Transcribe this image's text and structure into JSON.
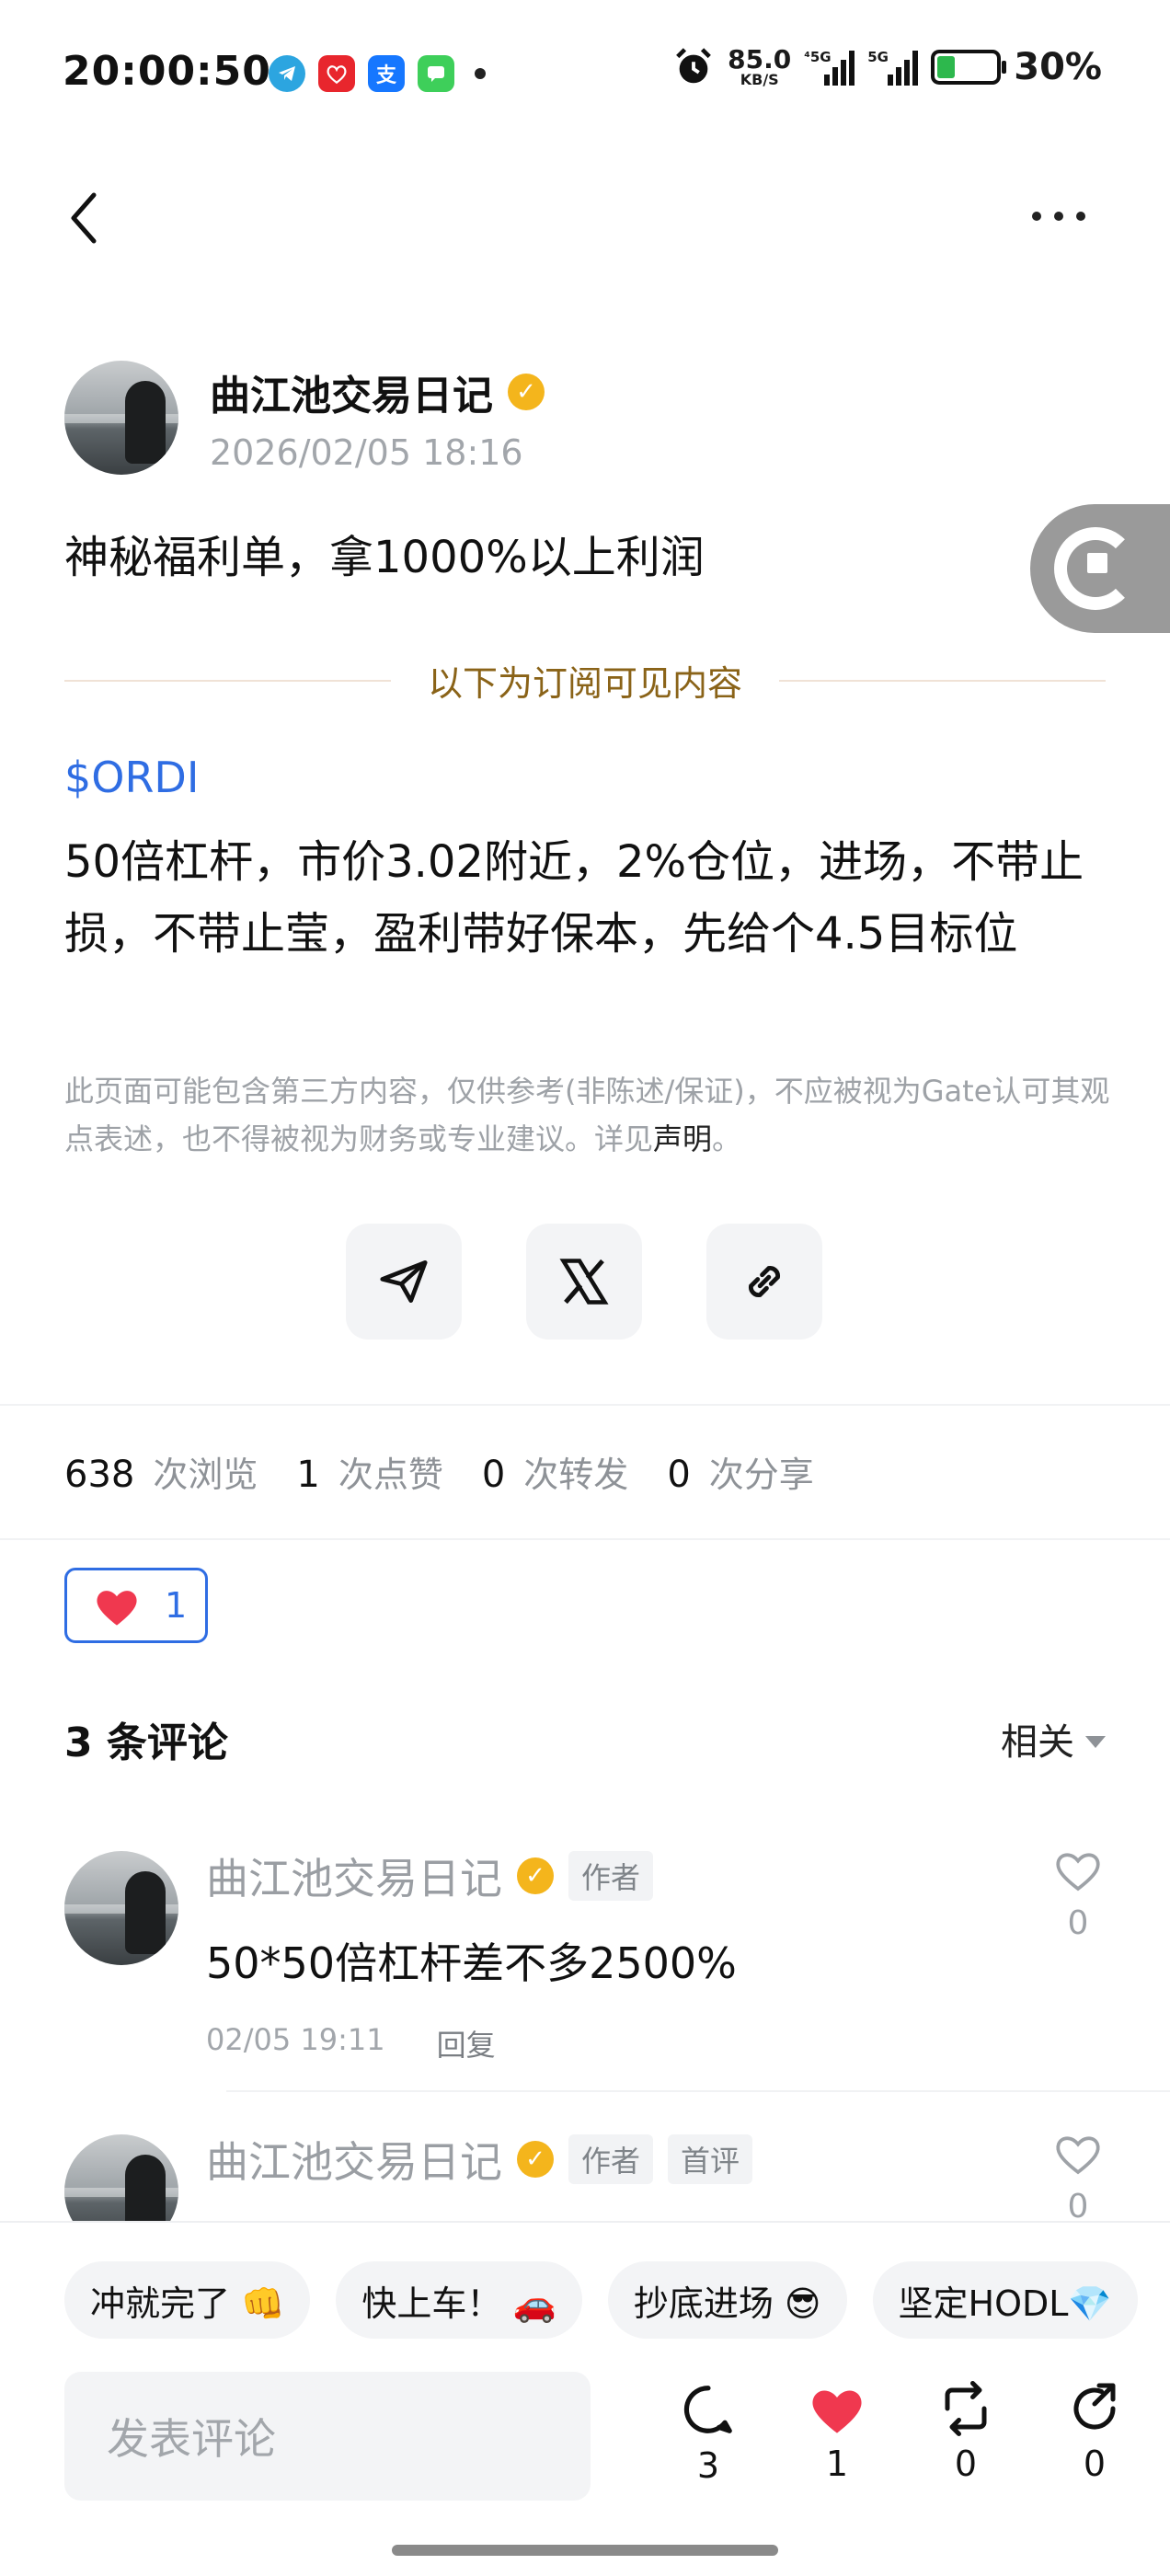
{
  "status_bar": {
    "time": "20:00:50",
    "net_speed_value": "85.0",
    "net_speed_unit": "KB/S",
    "sim1_label": "⁴5G",
    "sim2_label": "5G",
    "battery": "30%",
    "battery_level": 0.3,
    "app_icons": [
      "telegram-icon",
      "taobao-icon",
      "alipay-icon",
      "messages-icon"
    ],
    "app_icon_glyphs": [
      "",
      "",
      "支",
      ""
    ]
  },
  "nav": {
    "back_icon": "chevron-left-icon",
    "more_icon": "more-horizontal-icon"
  },
  "author": {
    "name": "曲江池交易日记",
    "date": "2026/02/05 18:16",
    "verified_glyph": "✓"
  },
  "post": {
    "title": "神秘福利单，拿1000%以上利润",
    "subscriber_divider": "以下为订阅可见内容",
    "ticker": "$ORDI",
    "body": "50倍杠杆，市价3.02附近，2%仓位，进场，不带止损，不带止莹，盈利带好保本，先给个4.5目标位",
    "disclaimer": "此页面可能包含第三方内容，仅供参考(非陈述/保证)，不应被视为Gate认可其观点表述，也不得被视为财务或专业建议。详见",
    "disclaimer_link": "声明",
    "disclaimer_end": "。"
  },
  "share": [
    "telegram-share-icon",
    "x-share-icon",
    "copy-link-icon"
  ],
  "stats": {
    "views": "638",
    "views_label": "次浏览",
    "likes": "1",
    "likes_label": "次点赞",
    "reposts": "0",
    "reposts_label": "次转发",
    "shares": "0",
    "shares_label": "次分享"
  },
  "like_button": {
    "count": "1"
  },
  "comments": {
    "title": "3 条评论",
    "sort": "相关",
    "items": [
      {
        "name": "曲江池交易日记",
        "tags": [
          "作者"
        ],
        "text": "50*50倍杠杆差不多2500%",
        "time": "02/05 19:11",
        "reply": "回复",
        "likes": "0"
      },
      {
        "name": "曲江池交易日记",
        "tags": [
          "作者",
          "首评"
        ],
        "text": "",
        "time": "",
        "reply": "",
        "likes": "0"
      }
    ]
  },
  "quick_replies": [
    "冲就完了 👊",
    "快上车！ 🚗",
    "抄底进场 😎",
    "坚定HODL💎"
  ],
  "comment_input": {
    "placeholder": "发表评论"
  },
  "actions": {
    "comments": "3",
    "likes": "1",
    "reposts": "0",
    "shares": "0"
  },
  "colors": {
    "accent": "#2f6de3",
    "heart": "#f0384f",
    "verified": "#f4b51c",
    "gold_text": "#8a6318"
  }
}
